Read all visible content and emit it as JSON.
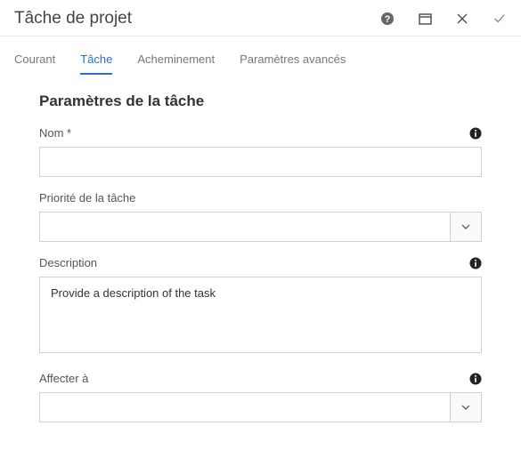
{
  "header": {
    "title": "Tâche de projet"
  },
  "tabs": [
    {
      "label": "Courant",
      "active": false
    },
    {
      "label": "Tâche",
      "active": true
    },
    {
      "label": "Acheminement",
      "active": false
    },
    {
      "label": "Paramètres avancés",
      "active": false
    }
  ],
  "section": {
    "title": "Paramètres de la tâche"
  },
  "fields": {
    "name": {
      "label": "Nom *",
      "value": ""
    },
    "priority": {
      "label": "Priorité de la tâche",
      "value": ""
    },
    "description": {
      "label": "Description",
      "value": "Provide a description of the task"
    },
    "assign": {
      "label": "Affecter à",
      "value": ""
    }
  }
}
